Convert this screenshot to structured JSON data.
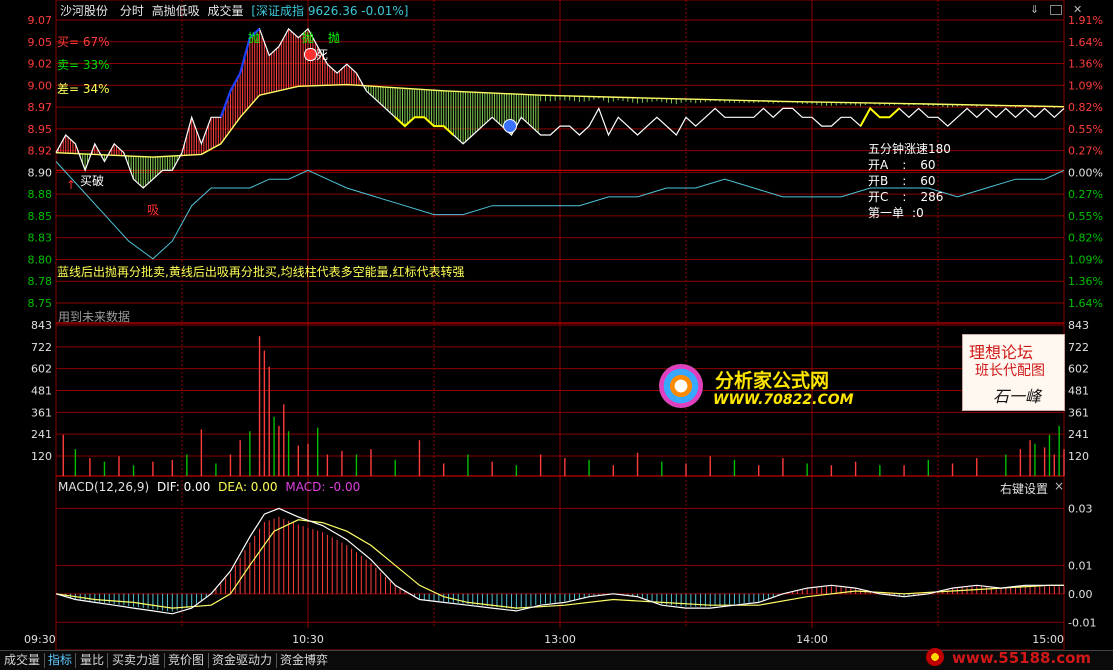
{
  "header": {
    "stock": "沙河股份",
    "mode": "分时",
    "indicator": "高抛低吸",
    "volume_label": "成交量",
    "index_text": "[深证成指 9626.36 -0.01%]"
  },
  "left_overlay": {
    "buy": "买= 67%",
    "sell": "卖= 33%",
    "diff": "差= 34%"
  },
  "price_axis": {
    "left": [
      "9.07",
      "9.05",
      "9.02",
      "9.00",
      "8.97",
      "8.95",
      "8.92",
      "8.90",
      "8.88",
      "8.85",
      "8.83",
      "8.80",
      "8.78",
      "8.75"
    ],
    "right": [
      "1.91%",
      "1.64%",
      "1.36%",
      "1.09%",
      "0.82%",
      "0.55%",
      "0.27%",
      "0.00%",
      "0.27%",
      "0.55%",
      "0.82%",
      "1.09%",
      "1.36%",
      "1.64%"
    ]
  },
  "volume_axis": [
    "843",
    "722",
    "602",
    "481",
    "361",
    "241",
    "120"
  ],
  "macd_axis": [
    "0.03",
    "0.01",
    "0.00",
    "-0.01"
  ],
  "time_axis": [
    "09:30",
    "10:30",
    "13:00",
    "14:00",
    "15:00"
  ],
  "price_notes": {
    "description": "蓝线后出抛再分批卖,黄线后出吸再分批买,均线柱代表多空能量,红标代表转强",
    "future_data": "用到未来数据",
    "buy_mark": "买破",
    "low_mark": "吸",
    "sell_mark_1": "抛",
    "sell_mark_2": "抛",
    "sell_mark_3": "抛",
    "death_mark": "死",
    "stats": {
      "title": "五分钟涨速",
      "title_value": "180",
      "a_label": "开A",
      "a_sep": ":",
      "a_value": "60",
      "b_label": "开B",
      "b_sep": ":",
      "b_value": "60",
      "c_label": "开C",
      "c_sep": ":",
      "c_value": "286",
      "first_label": "第一单",
      "first_sep": ":",
      "first_value": "0"
    }
  },
  "watermarks": {
    "brand": "分析家公式网",
    "url": "WWW.70822.COM",
    "forum_title": "理想论坛",
    "forum_sub": "班长代配图",
    "signature": "石一峰",
    "corner": "www.55188.com"
  },
  "macd": {
    "title": "MACD(12,26,9)",
    "dif": "DIF: 0.00",
    "dea": "DEA: 0.00",
    "macd": "MACD: -0.00",
    "settings": "右键设置",
    "close": "×"
  },
  "toolbar": {
    "icons": [
      "arrow-icon",
      "square-icon",
      "close-icon"
    ]
  },
  "bottom_tabs": [
    "成交量",
    "指标",
    "量比",
    "买卖力道",
    "竞价图",
    "资金驱动力",
    "资金博弈"
  ],
  "active_tab": 1,
  "colors": {
    "up": "#ff3c3c",
    "down": "#00c000",
    "grid": "#8b0000",
    "price_line": "#ffffff",
    "avg_line": "#ffff66",
    "cyan_line": "#4fc3d8",
    "blue_line": "#2040ff",
    "yellow_line": "#ffff00"
  },
  "chart_data": [
    {
      "type": "line",
      "name": "price",
      "y_ticks": [
        9.07,
        9.05,
        9.02,
        9.0,
        8.97,
        8.95,
        8.92,
        8.9,
        8.88,
        8.85,
        8.83,
        8.8,
        8.78,
        8.75
      ],
      "ylim": [
        8.75,
        9.07
      ],
      "x_times": [
        "09:30",
        "10:30",
        "13:00",
        "14:00",
        "15:00"
      ],
      "price_points": [
        [
          0,
          8.92
        ],
        [
          4,
          8.94
        ],
        [
          8,
          8.93
        ],
        [
          12,
          8.9
        ],
        [
          16,
          8.93
        ],
        [
          20,
          8.91
        ],
        [
          24,
          8.93
        ],
        [
          28,
          8.92
        ],
        [
          32,
          8.89
        ],
        [
          36,
          8.88
        ],
        [
          40,
          8.89
        ],
        [
          44,
          8.9
        ],
        [
          48,
          8.9
        ],
        [
          52,
          8.92
        ],
        [
          56,
          8.96
        ],
        [
          60,
          8.93
        ],
        [
          64,
          8.96
        ],
        [
          68,
          8.96
        ],
        [
          72,
          8.99
        ],
        [
          76,
          9.01
        ],
        [
          80,
          9.05
        ],
        [
          84,
          9.06
        ],
        [
          88,
          9.03
        ],
        [
          92,
          9.04
        ],
        [
          96,
          9.06
        ],
        [
          100,
          9.05
        ],
        [
          104,
          9.06
        ],
        [
          108,
          9.04
        ],
        [
          112,
          9.02
        ],
        [
          116,
          9.01
        ],
        [
          120,
          9.02
        ],
        [
          124,
          9.01
        ],
        [
          128,
          8.99
        ],
        [
          132,
          8.98
        ],
        [
          136,
          8.97
        ],
        [
          140,
          8.96
        ],
        [
          144,
          8.95
        ],
        [
          148,
          8.96
        ],
        [
          152,
          8.96
        ],
        [
          156,
          8.95
        ],
        [
          160,
          8.95
        ],
        [
          164,
          8.94
        ],
        [
          168,
          8.93
        ],
        [
          172,
          8.94
        ],
        [
          176,
          8.95
        ],
        [
          180,
          8.96
        ],
        [
          184,
          8.95
        ],
        [
          188,
          8.94
        ],
        [
          192,
          8.96
        ],
        [
          196,
          8.95
        ],
        [
          200,
          8.94
        ],
        [
          204,
          8.94
        ],
        [
          208,
          8.95
        ],
        [
          212,
          8.95
        ],
        [
          216,
          8.94
        ],
        [
          220,
          8.95
        ],
        [
          224,
          8.97
        ],
        [
          228,
          8.94
        ],
        [
          232,
          8.96
        ],
        [
          236,
          8.95
        ],
        [
          240,
          8.94
        ],
        [
          244,
          8.95
        ],
        [
          248,
          8.96
        ],
        [
          252,
          8.95
        ],
        [
          256,
          8.94
        ],
        [
          260,
          8.96
        ],
        [
          264,
          8.95
        ],
        [
          268,
          8.96
        ],
        [
          272,
          8.97
        ],
        [
          276,
          8.96
        ],
        [
          280,
          8.96
        ],
        [
          284,
          8.96
        ],
        [
          288,
          8.96
        ],
        [
          292,
          8.97
        ],
        [
          296,
          8.96
        ],
        [
          300,
          8.97
        ],
        [
          304,
          8.97
        ],
        [
          308,
          8.96
        ],
        [
          312,
          8.96
        ],
        [
          316,
          8.95
        ],
        [
          320,
          8.95
        ],
        [
          324,
          8.96
        ],
        [
          328,
          8.96
        ],
        [
          332,
          8.95
        ],
        [
          336,
          8.97
        ],
        [
          340,
          8.96
        ],
        [
          344,
          8.96
        ],
        [
          348,
          8.97
        ],
        [
          352,
          8.96
        ],
        [
          356,
          8.97
        ],
        [
          360,
          8.96
        ],
        [
          364,
          8.96
        ],
        [
          368,
          8.95
        ],
        [
          372,
          8.96
        ],
        [
          376,
          8.97
        ],
        [
          380,
          8.96
        ],
        [
          384,
          8.97
        ],
        [
          388,
          8.96
        ],
        [
          392,
          8.97
        ],
        [
          396,
          8.96
        ],
        [
          400,
          8.97
        ],
        [
          404,
          8.96
        ],
        [
          408,
          8.97
        ],
        [
          412,
          8.96
        ],
        [
          416,
          8.97
        ]
      ],
      "avg_points": [
        [
          0,
          8.92
        ],
        [
          40,
          8.915
        ],
        [
          60,
          8.918
        ],
        [
          68,
          8.93
        ],
        [
          76,
          8.96
        ],
        [
          84,
          8.985
        ],
        [
          100,
          8.995
        ],
        [
          120,
          8.997
        ],
        [
          160,
          8.99
        ],
        [
          200,
          8.985
        ],
        [
          240,
          8.982
        ],
        [
          300,
          8.978
        ],
        [
          360,
          8.975
        ],
        [
          416,
          8.972
        ]
      ],
      "cyan_points": [
        [
          0,
          8.91
        ],
        [
          10,
          8.88
        ],
        [
          20,
          8.85
        ],
        [
          30,
          8.82
        ],
        [
          40,
          8.8
        ],
        [
          48,
          8.82
        ],
        [
          56,
          8.86
        ],
        [
          64,
          8.88
        ],
        [
          72,
          8.88
        ],
        [
          80,
          8.88
        ],
        [
          88,
          8.89
        ],
        [
          96,
          8.89
        ],
        [
          104,
          8.9
        ],
        [
          112,
          8.89
        ],
        [
          120,
          8.88
        ],
        [
          132,
          8.87
        ],
        [
          144,
          8.86
        ],
        [
          156,
          8.85
        ],
        [
          168,
          8.85
        ],
        [
          180,
          8.86
        ],
        [
          192,
          8.86
        ],
        [
          204,
          8.86
        ],
        [
          216,
          8.86
        ],
        [
          228,
          8.87
        ],
        [
          240,
          8.87
        ],
        [
          252,
          8.88
        ],
        [
          264,
          8.88
        ],
        [
          276,
          8.89
        ],
        [
          288,
          8.88
        ],
        [
          300,
          8.87
        ],
        [
          312,
          8.87
        ],
        [
          324,
          8.87
        ],
        [
          336,
          8.88
        ],
        [
          348,
          8.88
        ],
        [
          360,
          8.88
        ],
        [
          372,
          8.87
        ],
        [
          384,
          8.88
        ],
        [
          396,
          8.89
        ],
        [
          408,
          8.89
        ],
        [
          416,
          8.9
        ]
      ]
    },
    {
      "type": "bar",
      "name": "volume",
      "y_ticks": [
        843,
        722,
        602,
        481,
        361,
        241,
        120
      ],
      "ylim": [
        0,
        843
      ],
      "bars": [
        [
          3,
          230,
          1
        ],
        [
          8,
          150,
          0
        ],
        [
          14,
          100,
          1
        ],
        [
          20,
          80,
          0
        ],
        [
          26,
          110,
          1
        ],
        [
          32,
          60,
          0
        ],
        [
          40,
          80,
          1
        ],
        [
          48,
          90,
          1
        ],
        [
          54,
          120,
          0
        ],
        [
          60,
          260,
          1
        ],
        [
          66,
          70,
          0
        ],
        [
          72,
          120,
          1
        ],
        [
          76,
          200,
          1
        ],
        [
          80,
          250,
          0
        ],
        [
          84,
          780,
          1
        ],
        [
          86,
          700,
          1
        ],
        [
          88,
          610,
          1
        ],
        [
          90,
          330,
          0
        ],
        [
          92,
          280,
          1
        ],
        [
          94,
          400,
          1
        ],
        [
          96,
          250,
          0
        ],
        [
          100,
          170,
          1
        ],
        [
          104,
          180,
          1
        ],
        [
          108,
          270,
          0
        ],
        [
          112,
          120,
          1
        ],
        [
          118,
          140,
          1
        ],
        [
          124,
          120,
          0
        ],
        [
          130,
          150,
          1
        ],
        [
          140,
          90,
          0
        ],
        [
          150,
          200,
          1
        ],
        [
          160,
          70,
          1
        ],
        [
          170,
          120,
          0
        ],
        [
          180,
          80,
          1
        ],
        [
          190,
          60,
          0
        ],
        [
          200,
          120,
          1
        ],
        [
          210,
          100,
          1
        ],
        [
          220,
          90,
          0
        ],
        [
          230,
          60,
          1
        ],
        [
          240,
          130,
          1
        ],
        [
          250,
          80,
          0
        ],
        [
          260,
          70,
          1
        ],
        [
          270,
          110,
          1
        ],
        [
          280,
          90,
          0
        ],
        [
          290,
          60,
          1
        ],
        [
          300,
          100,
          1
        ],
        [
          310,
          70,
          0
        ],
        [
          320,
          60,
          1
        ],
        [
          330,
          80,
          1
        ],
        [
          340,
          60,
          0
        ],
        [
          350,
          60,
          1
        ],
        [
          360,
          90,
          0
        ],
        [
          370,
          70,
          1
        ],
        [
          380,
          100,
          1
        ],
        [
          392,
          120,
          0
        ],
        [
          398,
          150,
          1
        ],
        [
          402,
          200,
          1
        ],
        [
          404,
          180,
          0
        ],
        [
          408,
          160,
          1
        ],
        [
          410,
          230,
          0
        ],
        [
          412,
          120,
          1
        ],
        [
          414,
          280,
          0
        ],
        [
          416,
          150,
          1
        ]
      ]
    },
    {
      "type": "line",
      "name": "macd",
      "y_ticks": [
        0.03,
        0.01,
        0.0,
        -0.01
      ],
      "ylim": [
        -0.012,
        0.034
      ],
      "dif_points": [
        [
          0,
          0.0
        ],
        [
          8,
          -0.002
        ],
        [
          16,
          -0.003
        ],
        [
          24,
          -0.004
        ],
        [
          32,
          -0.005
        ],
        [
          40,
          -0.006
        ],
        [
          48,
          -0.007
        ],
        [
          56,
          -0.005
        ],
        [
          64,
          0.0
        ],
        [
          72,
          0.008
        ],
        [
          80,
          0.02
        ],
        [
          86,
          0.028
        ],
        [
          92,
          0.03
        ],
        [
          100,
          0.027
        ],
        [
          110,
          0.024
        ],
        [
          120,
          0.019
        ],
        [
          130,
          0.012
        ],
        [
          140,
          0.003
        ],
        [
          150,
          -0.002
        ],
        [
          160,
          -0.003
        ],
        [
          170,
          -0.004
        ],
        [
          180,
          -0.005
        ],
        [
          190,
          -0.006
        ],
        [
          200,
          -0.004
        ],
        [
          210,
          -0.003
        ],
        [
          220,
          -0.001
        ],
        [
          230,
          0.0
        ],
        [
          240,
          -0.001
        ],
        [
          250,
          -0.004
        ],
        [
          260,
          -0.005
        ],
        [
          270,
          -0.005
        ],
        [
          280,
          -0.004
        ],
        [
          290,
          -0.003
        ],
        [
          300,
          0.0
        ],
        [
          310,
          0.002
        ],
        [
          320,
          0.003
        ],
        [
          330,
          0.002
        ],
        [
          340,
          0.0
        ],
        [
          350,
          -0.001
        ],
        [
          360,
          0.0
        ],
        [
          370,
          0.002
        ],
        [
          380,
          0.003
        ],
        [
          390,
          0.002
        ],
        [
          400,
          0.003
        ],
        [
          410,
          0.003
        ],
        [
          416,
          0.003
        ]
      ],
      "dea_points": [
        [
          0,
          0.0
        ],
        [
          16,
          -0.002
        ],
        [
          32,
          -0.003
        ],
        [
          48,
          -0.005
        ],
        [
          64,
          -0.004
        ],
        [
          72,
          0.0
        ],
        [
          80,
          0.01
        ],
        [
          90,
          0.022
        ],
        [
          100,
          0.026
        ],
        [
          110,
          0.025
        ],
        [
          120,
          0.022
        ],
        [
          130,
          0.017
        ],
        [
          140,
          0.01
        ],
        [
          150,
          0.003
        ],
        [
          160,
          -0.001
        ],
        [
          170,
          -0.003
        ],
        [
          190,
          -0.005
        ],
        [
          210,
          -0.004
        ],
        [
          230,
          -0.002
        ],
        [
          250,
          -0.003
        ],
        [
          270,
          -0.004
        ],
        [
          290,
          -0.004
        ],
        [
          310,
          -0.001
        ],
        [
          330,
          0.001
        ],
        [
          350,
          0.0
        ],
        [
          370,
          0.001
        ],
        [
          390,
          0.002
        ],
        [
          410,
          0.003
        ],
        [
          416,
          0.003
        ]
      ]
    }
  ]
}
